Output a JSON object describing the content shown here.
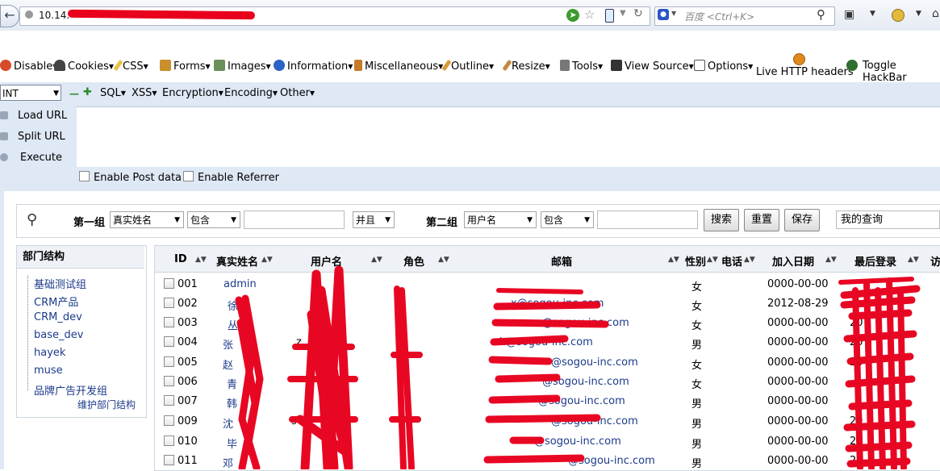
{
  "browser": {
    "url_visible": "10.14.",
    "search_placeholder": "百度 <Ctrl+K>"
  },
  "devbar": {
    "items": [
      "Disable",
      "Cookies",
      "CSS",
      "Forms",
      "Images",
      "Information",
      "Miscellaneous",
      "Outline",
      "Resize",
      "Tools",
      "View Source",
      "Options"
    ],
    "live_http": "Live HTTP headers",
    "toggle_hackbar": "Toggle HackBar"
  },
  "hackbar": {
    "type_select": "INT",
    "menus": [
      "SQL",
      "XSS",
      "Encryption",
      "Encoding",
      "Other"
    ],
    "load_url": "Load URL",
    "split_url": "Split URL",
    "execute": "Execute",
    "enable_post": "Enable Post data",
    "enable_referrer": "Enable Referrer"
  },
  "filter": {
    "group1_label": "第一组",
    "group1_field": "真实姓名",
    "group1_op": "包含",
    "logic": "并且",
    "group2_label": "第二组",
    "group2_field": "用户名",
    "group2_op": "包含",
    "search_btn": "搜索",
    "reset_btn": "重置",
    "save_btn": "保存",
    "my_query": "我的查询"
  },
  "departments": {
    "title": "部门结构",
    "items": [
      "基础测试组",
      "CRM产品",
      "CRM_dev",
      "base_dev",
      "hayek",
      "muse",
      "品牌广告开发组"
    ],
    "manage_link": "维护部门结构"
  },
  "table": {
    "headers": {
      "id": "ID",
      "real_name": "真实姓名",
      "username": "用户名",
      "role": "角色",
      "email": "邮箱",
      "gender": "性别",
      "phone": "电话",
      "join_date": "加入日期",
      "last_login": "最后登录",
      "visits": "访"
    },
    "rows": [
      {
        "id": "001",
        "name": "admin",
        "user": "a",
        "role": "",
        "email": "",
        "gender": "女",
        "join": "0000-00-00",
        "last": ""
      },
      {
        "id": "002",
        "name": "徐",
        "user": "",
        "role": "",
        "email": "x@sogou-inc.com",
        "gender": "女",
        "join": "2012-08-29",
        "last": ""
      },
      {
        "id": "003",
        "name": "丛",
        "user": "",
        "role": "",
        "email": "@sogou-inc.com",
        "gender": "女",
        "join": "0000-00-00",
        "last": "20"
      },
      {
        "id": "004",
        "name": "张",
        "user": "z",
        "role": "",
        "email": "zh@sogou-inc.com",
        "gender": "男",
        "join": "0000-00-00",
        "last": "20"
      },
      {
        "id": "005",
        "name": "赵",
        "user": "",
        "role": "",
        "email": "@sogou-inc.com",
        "gender": "女",
        "join": "0000-00-00",
        "last": "20"
      },
      {
        "id": "006",
        "name": "青",
        "user": "",
        "role": "",
        "email": "@sogou-inc.com",
        "gender": "女",
        "join": "0000-00-00",
        "last": ""
      },
      {
        "id": "007",
        "name": "韩",
        "user": "",
        "role": "",
        "email": "@sogou-inc.com",
        "gender": "男",
        "join": "0000-00-00",
        "last": ""
      },
      {
        "id": "009",
        "name": "沈",
        "user": "s",
        "role": "",
        "email": "@sogou-inc.com",
        "gender": "男",
        "join": "0000-00-00",
        "last": "20"
      },
      {
        "id": "010",
        "name": "毕",
        "user": "",
        "role": "",
        "email": "@sogou-inc.com",
        "gender": "男",
        "join": "0000-00-00",
        "last": "20"
      },
      {
        "id": "011",
        "name": "邓",
        "user": "",
        "role": "",
        "email": "@sogou-inc.com",
        "gender": "男",
        "join": "0000-00-00",
        "last": "20"
      }
    ]
  }
}
